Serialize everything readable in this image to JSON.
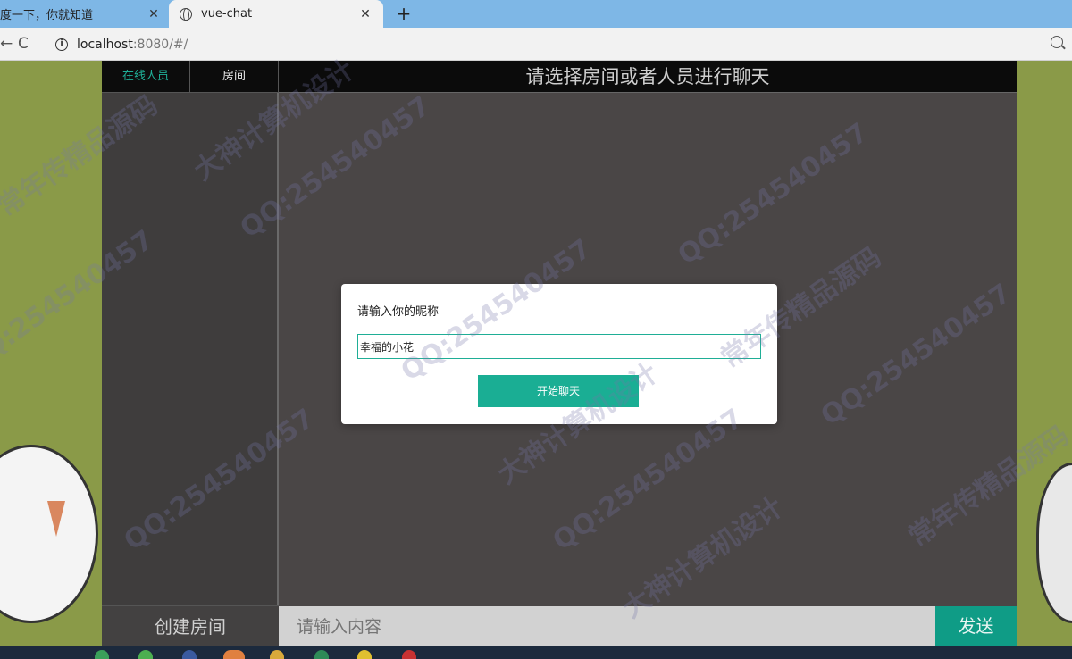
{
  "browser": {
    "tabs": [
      {
        "title": "度一下，你就知道",
        "close": "✕"
      },
      {
        "title": "vue-chat",
        "close": "✕"
      }
    ],
    "new_tab": "+",
    "back": "←",
    "reload": "C",
    "info_icon": "i",
    "url_host": "localhost",
    "url_path": ":8080/#/"
  },
  "sidebar": {
    "tabs": [
      {
        "label": "在线人员"
      },
      {
        "label": "房间"
      }
    ],
    "create_room": "创建房间"
  },
  "main": {
    "header": "请选择房间或者人员进行聊天",
    "message_placeholder": "请输入内容",
    "send": "发送"
  },
  "modal": {
    "label": "请输入你的昵称",
    "nickname_value": "幸福的小花",
    "start_button": "开始聊天"
  },
  "watermark": {
    "lines": [
      "QQ:254540457",
      "大神计算机设计",
      "常年传精品源码"
    ]
  },
  "colors": {
    "accent": "#1aae94",
    "send": "#0f9c86",
    "page_bg": "#8a9a48",
    "panel": "#4a4646"
  }
}
